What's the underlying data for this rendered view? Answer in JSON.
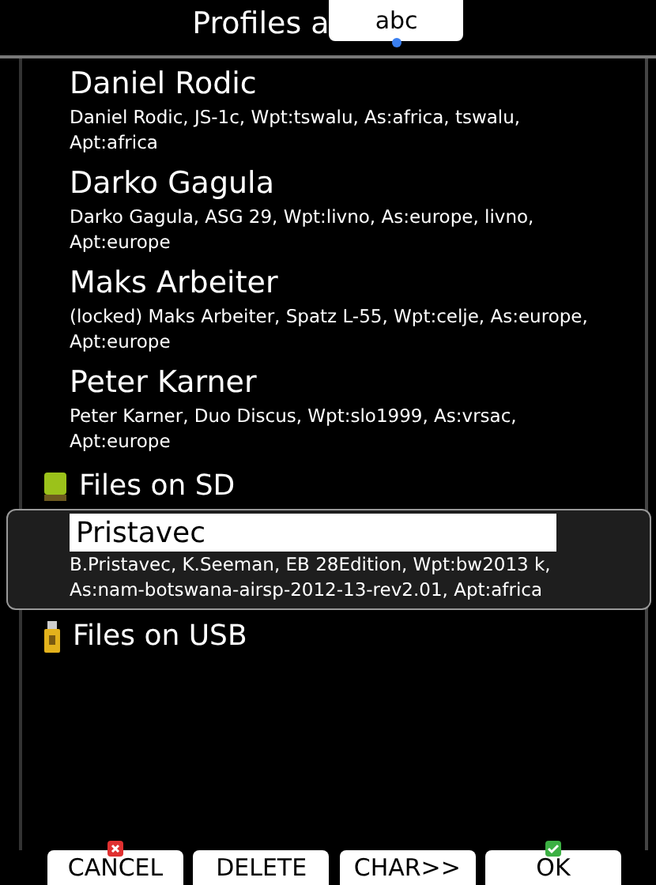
{
  "title": "Profiles a",
  "keyboard_tab": {
    "label": "abc"
  },
  "profiles": [
    {
      "name": "Daniel Rodic",
      "details": "Daniel Rodic, JS-1c, Wpt:tswalu, As:africa, tswalu, Apt:africa",
      "selected": false
    },
    {
      "name": "Darko Gagula",
      "details": "Darko Gagula, ASG 29, Wpt:livno, As:europe, livno, Apt:europe",
      "selected": false
    },
    {
      "name": "Maks Arbeiter",
      "details": "(locked) Maks Arbeiter, Spatz L-55, Wpt:celje, As:europe, Apt:europe",
      "selected": false
    },
    {
      "name": "Peter Karner",
      "details": "Peter Karner, Duo Discus, Wpt:slo1999, As:vrsac, Apt:europe",
      "selected": false
    }
  ],
  "folders": [
    {
      "label": "Files on SD",
      "kind": "sd",
      "items": [
        {
          "name": "Pristavec",
          "details": "B.Pristavec, K.Seeman, EB 28Edition, Wpt:bw2013 k, As:nam-botswana-airsp-2012-13-rev2.01, Apt:africa",
          "selected": true
        }
      ]
    },
    {
      "label": "Files on USB",
      "kind": "usb"
    }
  ],
  "buttons": [
    {
      "label": "CANCEL",
      "kind": "cancel"
    },
    {
      "label": "DELETE",
      "kind": "plain"
    },
    {
      "label": "CHAR>>",
      "kind": "plain"
    },
    {
      "label": "OK",
      "kind": "ok"
    }
  ]
}
